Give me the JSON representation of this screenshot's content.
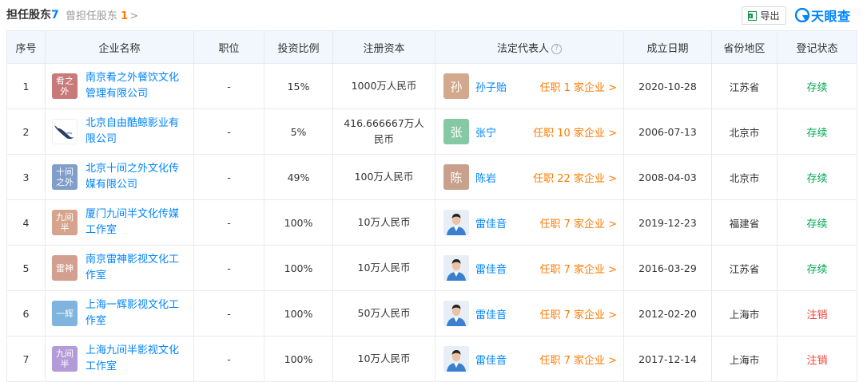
{
  "tabs": {
    "active": {
      "label": "担任股东",
      "count": "7"
    },
    "inactive": {
      "label": "曾担任股东",
      "count": "1",
      "chevron": ">"
    }
  },
  "toolbar": {
    "export_label": "导出",
    "export_icon": "excel-export-icon"
  },
  "brand": {
    "logo_text": "天眼查",
    "accent": "#0084ff"
  },
  "colors": {
    "link": "#0084ff",
    "orange": "#ff7a00",
    "green": "#00a854",
    "red": "#f04134"
  },
  "table": {
    "headers": [
      "序号",
      "企业名称",
      "职位",
      "投资比例",
      "注册资本",
      "法定代表人",
      "成立日期",
      "省份地区",
      "登记状态"
    ],
    "rows": [
      {
        "index": "1",
        "logo_text": "肴之\n外",
        "logo_color": "#c87a7a",
        "company": "南京肴之外餐饮文化管理有限公司",
        "position": "-",
        "ratio": "15%",
        "capital": "1000万人民币",
        "rep_char": "孙",
        "rep_color": "#d2a98c",
        "rep_photo": false,
        "rep_name": "孙子贻",
        "tenure": "任职 1 家企业 >",
        "date": "2020-10-28",
        "region": "江苏省",
        "status": "存续",
        "status_type": "active"
      },
      {
        "index": "2",
        "logo_text": "",
        "logo_color": "#ffffff",
        "logo_image": "whale-logo",
        "company": "北京自由酷鲸影业有限公司",
        "position": "-",
        "ratio": "5%",
        "capital": "416.666667万人民币",
        "rep_char": "张",
        "rep_color": "#85c9a4",
        "rep_photo": false,
        "rep_name": "张宁",
        "tenure": "任职 10 家企业 >",
        "date": "2006-07-13",
        "region": "北京市",
        "status": "存续",
        "status_type": "active"
      },
      {
        "index": "3",
        "logo_text": "十间\n之外",
        "logo_color": "#7f9ec9",
        "company": "北京十间之外文化传媒有限公司",
        "position": "-",
        "ratio": "49%",
        "capital": "100万人民币",
        "rep_char": "陈",
        "rep_color": "#c8a08c",
        "rep_photo": false,
        "rep_name": "陈岩",
        "tenure": "任职 22 家企业 >",
        "date": "2008-04-03",
        "region": "北京市",
        "status": "存续",
        "status_type": "active"
      },
      {
        "index": "4",
        "logo_text": "九间\n半",
        "logo_color": "#d6a48c",
        "company": "厦门九间半文化传媒工作室",
        "position": "-",
        "ratio": "100%",
        "capital": "10万人民币",
        "rep_char": "",
        "rep_color": "#e8eef5",
        "rep_photo": true,
        "rep_name": "雷佳音",
        "tenure": "任职 7 家企业 >",
        "date": "2019-12-23",
        "region": "福建省",
        "status": "存续",
        "status_type": "active"
      },
      {
        "index": "5",
        "logo_text": "雷神",
        "logo_color": "#d3a08f",
        "company": "南京雷神影视文化工作室",
        "position": "-",
        "ratio": "100%",
        "capital": "10万人民币",
        "rep_char": "",
        "rep_color": "#e8eef5",
        "rep_photo": true,
        "rep_name": "雷佳音",
        "tenure": "任职 7 家企业 >",
        "date": "2016-03-29",
        "region": "江苏省",
        "status": "存续",
        "status_type": "active"
      },
      {
        "index": "6",
        "logo_text": "一辉",
        "logo_color": "#7eb4dd",
        "company": "上海一辉影视文化工作室",
        "position": "-",
        "ratio": "100%",
        "capital": "50万人民币",
        "rep_char": "",
        "rep_color": "#e8eef5",
        "rep_photo": true,
        "rep_name": "雷佳音",
        "tenure": "任职 7 家企业 >",
        "date": "2012-02-20",
        "region": "上海市",
        "status": "注销",
        "status_type": "cancel"
      },
      {
        "index": "7",
        "logo_text": "九间\n半",
        "logo_color": "#b39ad8",
        "company": "上海九间半影视文化工作室",
        "position": "-",
        "ratio": "100%",
        "capital": "10万人民币",
        "rep_char": "",
        "rep_color": "#e8eef5",
        "rep_photo": true,
        "rep_name": "雷佳音",
        "tenure": "任职 7 家企业 >",
        "date": "2017-12-14",
        "region": "上海市",
        "status": "注销",
        "status_type": "cancel"
      }
    ]
  }
}
